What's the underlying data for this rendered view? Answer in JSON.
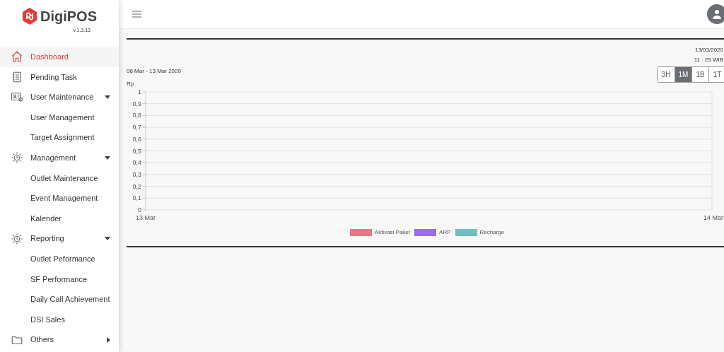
{
  "brand": {
    "name": "DigiPOS",
    "version": "v.1.3.13"
  },
  "sidebar": {
    "items": [
      {
        "label": "Dashboard",
        "kind": "home",
        "selected": true
      },
      {
        "label": "Pending Task",
        "kind": "task",
        "selected": false
      },
      {
        "label": "User Maintenance",
        "kind": "user-card",
        "selected": false,
        "expanded": true,
        "children": [
          {
            "label": "User Management",
            "selected": false
          },
          {
            "label": "Target Assignment",
            "selected": false
          }
        ]
      },
      {
        "label": "Management",
        "kind": "gear",
        "selected": false,
        "expanded": true,
        "children": [
          {
            "label": "Outlet Maintenance",
            "selected": false
          },
          {
            "label": "Event Management",
            "selected": false
          },
          {
            "label": "Kalender",
            "selected": false
          }
        ]
      },
      {
        "label": "Reporting",
        "kind": "gear",
        "selected": false,
        "expanded": true,
        "children": [
          {
            "label": "Outlet Peformance",
            "selected": false
          },
          {
            "label": "SF Performance",
            "selected": false
          },
          {
            "label": "Daily Call Achievement",
            "selected": false
          },
          {
            "label": "DSI Sales",
            "selected": false
          }
        ]
      },
      {
        "label": "Others",
        "kind": "folder",
        "selected": false,
        "expanded": false
      }
    ]
  },
  "dashboard": {
    "date": "13/03/2020",
    "time": "11 : 25 WIB",
    "range_label": "06 Mar - 13 Mar 2020",
    "ranges": [
      {
        "label": "3H",
        "selected": false
      },
      {
        "label": "1M",
        "selected": true
      },
      {
        "label": "1B",
        "selected": false
      },
      {
        "label": "1T",
        "selected": false
      }
    ],
    "chart_data": {
      "type": "line",
      "ylabel": "Rp",
      "categories": [
        "13 Mar",
        "14 Mar"
      ],
      "yticks": [
        {
          "value": 0,
          "label": "0"
        },
        {
          "value": 0.1,
          "label": "0,1"
        },
        {
          "value": 0.2,
          "label": "0,2"
        },
        {
          "value": 0.3,
          "label": "0,3"
        },
        {
          "value": 0.4,
          "label": "0,4"
        },
        {
          "value": 0.5,
          "label": "0,5"
        },
        {
          "value": 0.6,
          "label": "0,6"
        },
        {
          "value": 0.7,
          "label": "0,7"
        },
        {
          "value": 0.8,
          "label": "0,8"
        },
        {
          "value": 0.9,
          "label": "0,9"
        },
        {
          "value": 1,
          "label": "1"
        }
      ],
      "ylim": [
        0,
        1
      ],
      "series": [
        {
          "name": "Aktivasi Paket",
          "color": "#f07386",
          "values": [
            null,
            null
          ]
        },
        {
          "name": "ARP",
          "color": "#9a6af0",
          "values": [
            null,
            null
          ]
        },
        {
          "name": "Recharge",
          "color": "#6cc0c0",
          "values": [
            null,
            null
          ]
        }
      ]
    }
  }
}
